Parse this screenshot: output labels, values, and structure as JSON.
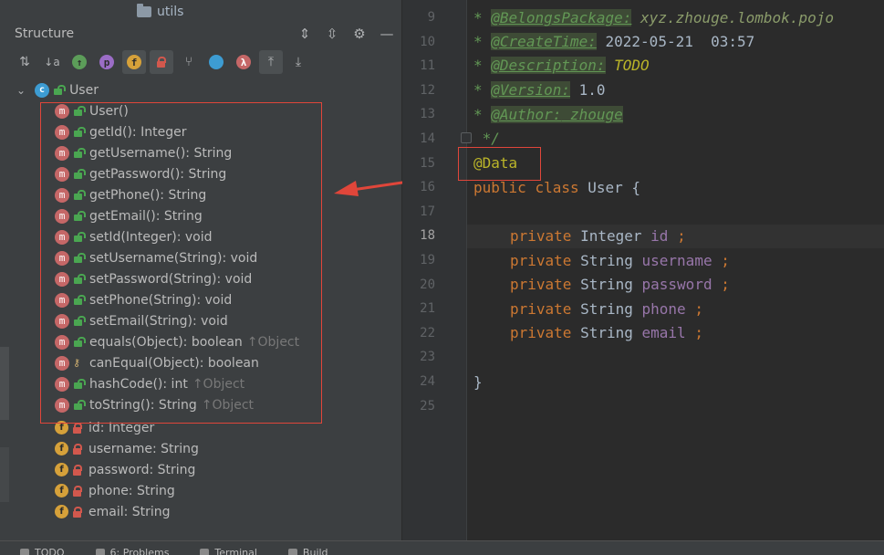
{
  "window": {
    "top_folder": "utils"
  },
  "structure": {
    "title": "Structure",
    "root": {
      "label": "User",
      "icon": "class-icon"
    },
    "methods": [
      {
        "label": "User()",
        "inherited": "",
        "vis": "unlock"
      },
      {
        "label": "getId(): Integer",
        "inherited": "",
        "vis": "unlock"
      },
      {
        "label": "getUsername(): String",
        "inherited": "",
        "vis": "unlock"
      },
      {
        "label": "getPassword(): String",
        "inherited": "",
        "vis": "unlock"
      },
      {
        "label": "getPhone(): String",
        "inherited": "",
        "vis": "unlock"
      },
      {
        "label": "getEmail(): String",
        "inherited": "",
        "vis": "unlock"
      },
      {
        "label": "setId(Integer): void",
        "inherited": "",
        "vis": "unlock"
      },
      {
        "label": "setUsername(String): void",
        "inherited": "",
        "vis": "unlock"
      },
      {
        "label": "setPassword(String): void",
        "inherited": "",
        "vis": "unlock"
      },
      {
        "label": "setPhone(String): void",
        "inherited": "",
        "vis": "unlock"
      },
      {
        "label": "setEmail(String): void",
        "inherited": "",
        "vis": "unlock"
      },
      {
        "label": "equals(Object): boolean",
        "inherited": "↑Object",
        "vis": "unlock"
      },
      {
        "label": "canEqual(Object): boolean",
        "inherited": "",
        "vis": "key"
      },
      {
        "label": "hashCode(): int",
        "inherited": "↑Object",
        "vis": "unlock"
      },
      {
        "label": "toString(): String",
        "inherited": "↑Object",
        "vis": "unlock"
      }
    ],
    "fields": [
      {
        "label": "id: Integer"
      },
      {
        "label": "username: String"
      },
      {
        "label": "password: String"
      },
      {
        "label": "phone: String"
      },
      {
        "label": "email: String"
      }
    ],
    "icon_letters": {
      "method": "m",
      "field": "f",
      "class": "c"
    }
  },
  "editor": {
    "line_numbers": [
      "9",
      "10",
      "11",
      "12",
      "13",
      "14",
      "15",
      "16",
      "17",
      "18",
      "19",
      "20",
      "21",
      "22",
      "23",
      "24",
      "25"
    ],
    "current_line": "18",
    "comment": {
      "star": "*",
      "belongs_tag": "@BelongsPackage:",
      "belongs_val": "xyz.zhouge.lombok.pojo",
      "create_tag": "@CreateTime:",
      "create_val": "2022-05-21  03:57",
      "desc_tag": "@Description:",
      "desc_val": "TODO",
      "version_tag": "@Version:",
      "version_val": "1.0",
      "author_tag": "@Author:",
      "author_val": "zhouge",
      "end": "*/"
    },
    "annotation": "@Data",
    "class_decl": {
      "kw1": "public",
      "kw2": "class",
      "name": "User",
      "brace": "{"
    },
    "fields": [
      {
        "kw": "private",
        "type": "Integer",
        "name": "id",
        "semi": ";"
      },
      {
        "kw": "private",
        "type": "String",
        "name": "username",
        "semi": ";"
      },
      {
        "kw": "private",
        "type": "String",
        "name": "password",
        "semi": ";"
      },
      {
        "kw": "private",
        "type": "String",
        "name": "phone",
        "semi": ";"
      },
      {
        "kw": "private",
        "type": "String",
        "name": "email",
        "semi": ";"
      }
    ],
    "close_brace": "}"
  },
  "statusbar": {
    "items": [
      "TODO",
      "6: Problems",
      "Terminal",
      "Build"
    ]
  },
  "colors": {
    "highlight_box": "#e0463a",
    "arrow": "#e0463a"
  }
}
